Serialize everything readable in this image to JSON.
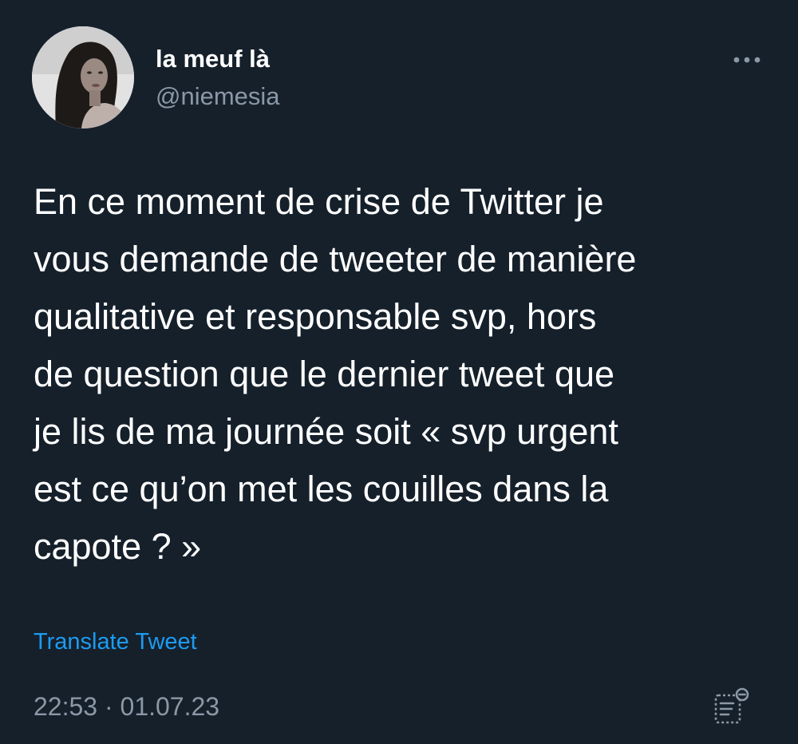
{
  "tweet": {
    "author": {
      "display_name": "la meuf là",
      "handle": "@niemesia"
    },
    "text": "En ce moment de crise de Twitter je\nvous demande de tweeter de manière\nqualitative et responsable svp, hors\nde question que le dernier tweet que\nje lis de ma journée soit « svp urgent\nest ce qu’on met les couilles dans la\ncapote ? »",
    "translate_label": "Translate Tweet",
    "time": "22:53",
    "separator": "·",
    "date": "01.07.23"
  },
  "icons": {
    "more": "more-horizontal-icon",
    "analytics": "tweet-analytics-icon"
  },
  "colors": {
    "background": "#15202b",
    "text_primary": "#ffffff",
    "text_secondary": "#8b98a5",
    "link": "#1d9bf0"
  }
}
